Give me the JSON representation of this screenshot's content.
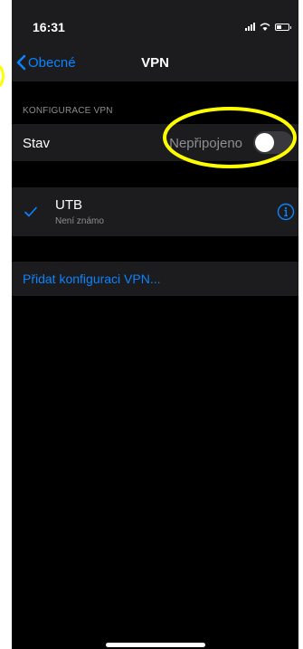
{
  "status_bar": {
    "time": "16:31"
  },
  "nav": {
    "back_label": "Obecné",
    "title": "VPN"
  },
  "config": {
    "section_header": "KONFIGURACE VPN",
    "status_label": "Stav",
    "status_value": "Nepřipojeno",
    "toggle_on": false
  },
  "vpn_list": [
    {
      "name": "UTB",
      "subtitle": "Není známo",
      "selected": true
    }
  ],
  "actions": {
    "add_config_label": "Přidat konfiguraci VPN..."
  },
  "colors": {
    "accent": "#0a84ff",
    "highlight": "#ffff00",
    "cell_background": "#1c1c1e",
    "secondary_text": "#8e8e93"
  }
}
